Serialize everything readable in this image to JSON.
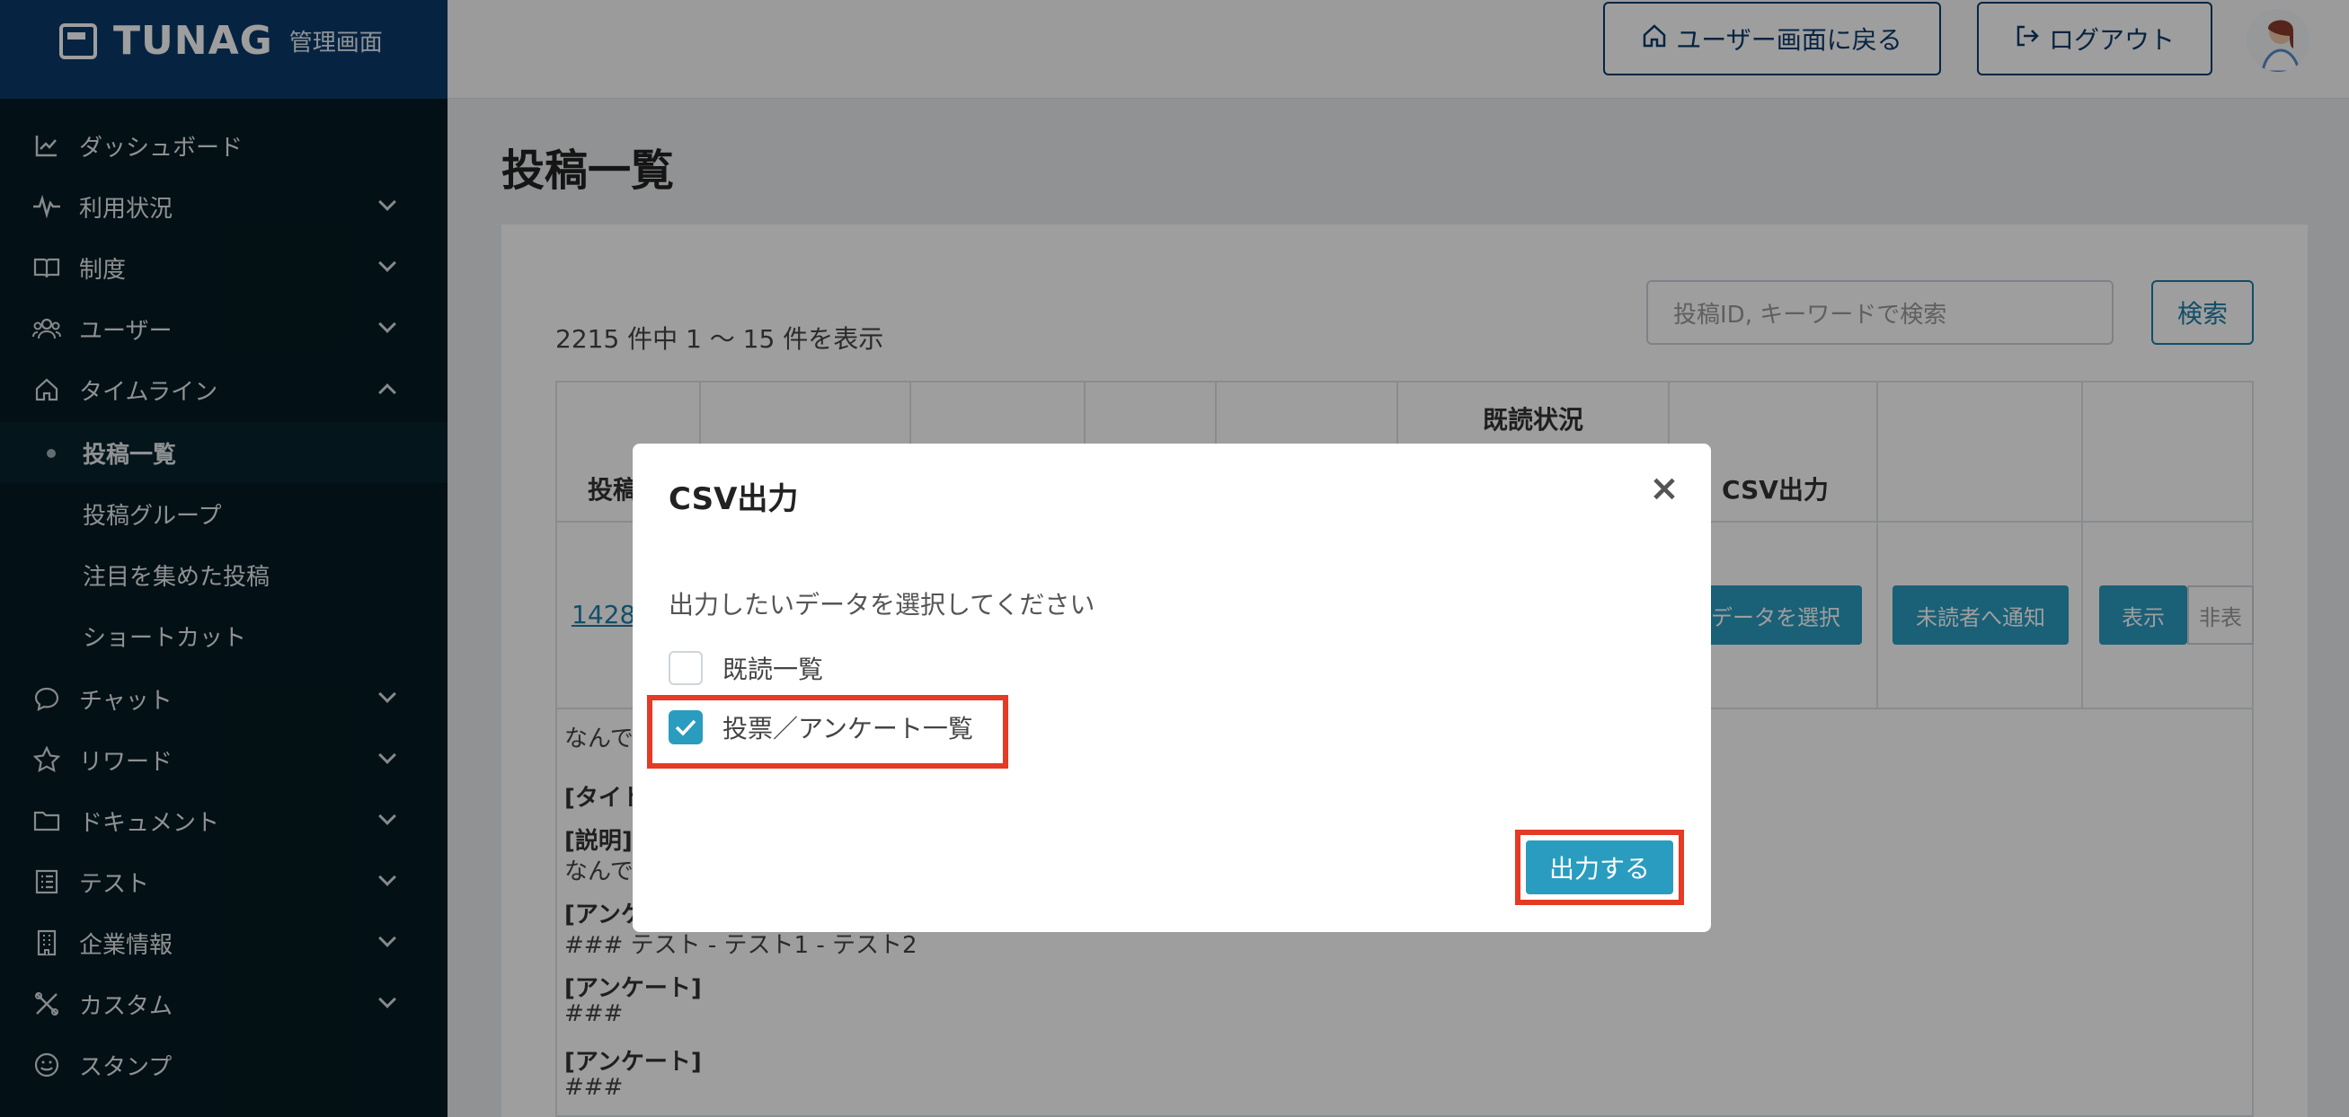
{
  "app": {
    "brand": "TUNAG",
    "subtitle": "管理画面"
  },
  "header": {
    "back_label": "ユーザー画面に戻る",
    "logout_label": "ログアウト"
  },
  "sidebar": {
    "items": [
      {
        "label": "ダッシュボード",
        "icon": "chart-line-icon"
      },
      {
        "label": "利用状況",
        "icon": "pulse-icon"
      },
      {
        "label": "制度",
        "icon": "book-icon"
      },
      {
        "label": "ユーザー",
        "icon": "users-icon"
      },
      {
        "label": "タイムライン",
        "icon": "home-icon"
      },
      {
        "label": "チャット",
        "icon": "chat-icon"
      },
      {
        "label": "リワード",
        "icon": "star-icon"
      },
      {
        "label": "ドキュメント",
        "icon": "folder-icon"
      },
      {
        "label": "テスト",
        "icon": "list-icon"
      },
      {
        "label": "企業情報",
        "icon": "building-icon"
      },
      {
        "label": "カスタム",
        "icon": "tools-icon"
      },
      {
        "label": "スタンプ",
        "icon": "smile-icon"
      }
    ],
    "sub_items": [
      {
        "label": "投稿一覧"
      },
      {
        "label": "投稿グループ"
      },
      {
        "label": "注目を集めた投稿"
      },
      {
        "label": "ショートカット"
      }
    ]
  },
  "main": {
    "title": "投稿一覧",
    "search": {
      "placeholder": "投稿ID, キーワードで検索",
      "button": "検索"
    },
    "count_text": "2215 件中 1 〜 15 件を表示",
    "table": {
      "headers": {
        "id": "投稿",
        "read_status": "既読状況",
        "csv": "CSV出力"
      },
      "row": {
        "id_link": "1428",
        "select_data": "データを選択",
        "notify_unread": "未読者へ通知",
        "show": "表示",
        "hide": "非表"
      },
      "body_lines": [
        {
          "text": "なんで",
          "bold": false
        },
        {
          "text": "[タイト",
          "bold": true
        },
        {
          "text": "[説明]",
          "bold": true
        },
        {
          "text": "なんで",
          "bold": false
        },
        {
          "text": "[アンケ",
          "bold": true
        },
        {
          "text": "### テスト - テスト1 - テスト2",
          "bold": false
        },
        {
          "text": "[アンケート]",
          "bold": true
        },
        {
          "text": "###",
          "bold": false
        },
        {
          "text": "[アンケート]",
          "bold": true
        },
        {
          "text": "###",
          "bold": false
        }
      ]
    }
  },
  "modal": {
    "title": "CSV出力",
    "close": "×",
    "description": "出力したいデータを選択してください",
    "options": [
      {
        "label": "既読一覧",
        "checked": false
      },
      {
        "label": "投票／アンケート一覧",
        "checked": true
      }
    ],
    "submit": "出力する"
  },
  "colors": {
    "accent": "#2a9cc0",
    "navy": "#0b3b6b",
    "highlight": "#e53a26",
    "sidebar": "#051b22"
  }
}
